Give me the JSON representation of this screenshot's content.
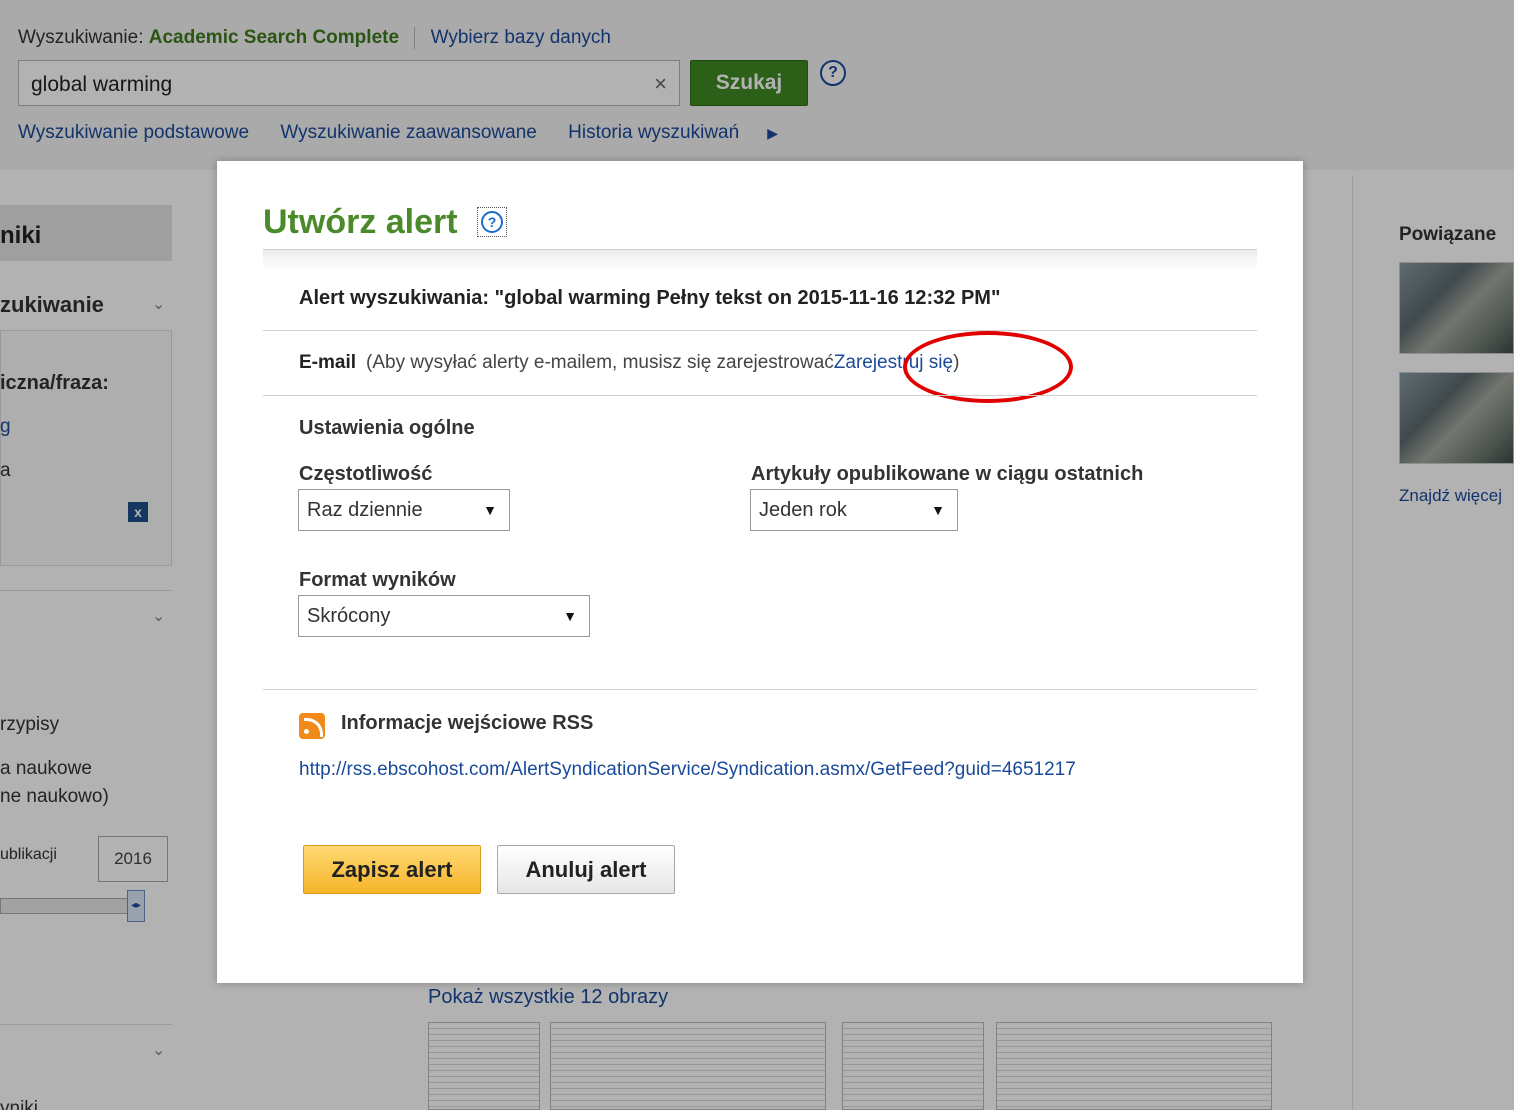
{
  "header": {
    "search_prefix": "Wyszukiwanie:",
    "database_name": "Academic Search Complete",
    "choose_databases": "Wybierz bazy danych",
    "search_value": "global warming",
    "clear_glyph": "×",
    "search_button": "Szukaj",
    "help_glyph": "?",
    "nav": {
      "basic": "Wyszukiwanie podstawowe",
      "advanced": "Wyszukiwanie zaawansowane",
      "history": "Historia wyszukiwań"
    }
  },
  "left_panel": {
    "heading": "niki",
    "section": "zukiwanie",
    "phrase_label": "iczna/fraza:",
    "term_g": "g",
    "term_a": "a",
    "remove_glyph": "x",
    "footnotes": "rzypisy",
    "scholarly_1": "a naukowe",
    "scholarly_2": "ne naukowo)",
    "pub_year_label": "ublikacji",
    "pub_year_value": "2016",
    "bottom_text": "yniki"
  },
  "right_panel": {
    "title": "Powiązane",
    "find_more": "Znajdź więcej"
  },
  "results": {
    "show_all_images": "Pokaż wszystkie 12 obrazy"
  },
  "dialog": {
    "title": "Utwórz alert",
    "help_glyph": "?",
    "alert_name": "Alert wyszukiwania: \"global warming Pełny tekst on 2015-11-16 12:32 PM\"",
    "email_label": "E-mail",
    "email_note": "(Aby wysyłać alerty e-mailem, musisz się zarejestrować",
    "register_link": "Zarejestruj się",
    "email_note_close": ")",
    "general_settings": "Ustawienia ogólne",
    "frequency_label": "Częstotliwość",
    "frequency_value": "Raz dziennie",
    "published_label": "Artykuły opublikowane w ciągu ostatnich",
    "published_value": "Jeden rok",
    "format_label": "Format wyników",
    "format_value": "Skrócony",
    "rss_label": "Informacje wejściowe RSS",
    "rss_url": "http://rss.ebscohost.com/AlertSyndicationService/Syndication.asmx/GetFeed?guid=4651217",
    "save_button": "Zapisz alert",
    "cancel_button": "Anuluj alert"
  },
  "colors": {
    "title_green": "#4a8a2a",
    "link_blue": "#1a4a9a",
    "search_button_green": "#3f8a25",
    "save_button_yellow": "#f5b529",
    "highlight_red": "#e00000"
  }
}
